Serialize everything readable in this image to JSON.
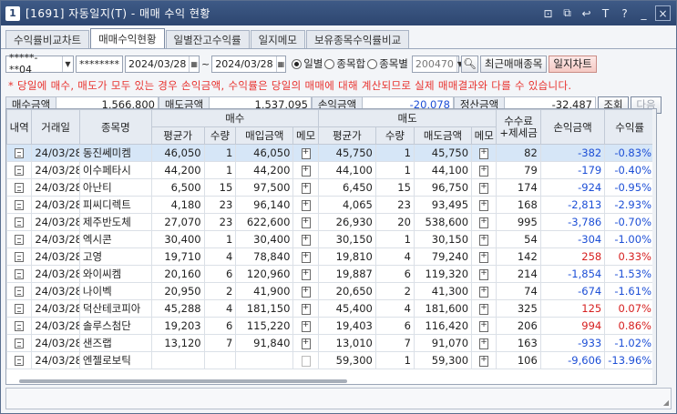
{
  "window": {
    "number": "1",
    "title": "[1691] 자동일지(T) - 매매 수익 현황"
  },
  "title_icons": [
    "⊡",
    "⧉",
    "↩",
    "T",
    "?",
    "_",
    "×"
  ],
  "tabs": [
    "수익률비교차트",
    "매매수익현황",
    "일별잔고수익률",
    "일지메모",
    "보유종목수익률비교"
  ],
  "active_tab": 1,
  "toolbar": {
    "account": "*****-**04",
    "password": "********",
    "date_from": "2024/03/28",
    "date_sep": "~",
    "date_to": "2024/03/28",
    "radio_options": [
      "일별",
      "종목합",
      "종목별"
    ],
    "radio_selected": 0,
    "stock_code": "200470",
    "recent_btn": "최근매매종목",
    "chart_btn": "일지차트"
  },
  "notice": "* 당일에 매수, 매도가 모두 있는 경우 손익금액, 수익률은 당일의 매매에 대해 계산되므로 실제 매매결과와 다를 수 있습니다.",
  "summary": {
    "buy_label": "매수금액",
    "buy_value": "1,566,800",
    "sell_label": "매도금액",
    "sell_value": "1,537,095",
    "pnl_label": "손익금액",
    "pnl_value": "-20,078",
    "settle_label": "정산금액",
    "settle_value": "-32,487",
    "query_btn": "조회",
    "next_btn": "다음"
  },
  "table": {
    "headers": {
      "detail": "내역",
      "date": "거래일",
      "name": "종목명",
      "buy": "매수",
      "sell": "매도",
      "fee": "수수료\n+제세금",
      "pnl": "손익금액",
      "rate": "수익률",
      "avg": "평균가",
      "qty": "수량",
      "buy_amt": "매입금액",
      "memo": "메모",
      "sell_amt": "매도금액"
    },
    "rows": [
      {
        "date": "24/03/28",
        "name": "동진쎄미켐",
        "b_avg": "46,050",
        "b_qty": "1",
        "b_amt": "46,050",
        "s_avg": "45,750",
        "s_qty": "1",
        "s_amt": "45,750",
        "fee": "82",
        "pnl": "-382",
        "rate": "-0.83%",
        "sign": "neg",
        "sel": true
      },
      {
        "date": "24/03/28",
        "name": "이수페타시",
        "b_avg": "44,200",
        "b_qty": "1",
        "b_amt": "44,200",
        "s_avg": "44,100",
        "s_qty": "1",
        "s_amt": "44,100",
        "fee": "79",
        "pnl": "-179",
        "rate": "-0.40%",
        "sign": "neg"
      },
      {
        "date": "24/03/28",
        "name": "아난티",
        "b_avg": "6,500",
        "b_qty": "15",
        "b_amt": "97,500",
        "s_avg": "6,450",
        "s_qty": "15",
        "s_amt": "96,750",
        "fee": "174",
        "pnl": "-924",
        "rate": "-0.95%",
        "sign": "neg"
      },
      {
        "date": "24/03/28",
        "name": "피씨디렉트",
        "b_avg": "4,180",
        "b_qty": "23",
        "b_amt": "96,140",
        "s_avg": "4,065",
        "s_qty": "23",
        "s_amt": "93,495",
        "fee": "168",
        "pnl": "-2,813",
        "rate": "-2.93%",
        "sign": "neg"
      },
      {
        "date": "24/03/28",
        "name": "제주반도체",
        "b_avg": "27,070",
        "b_qty": "23",
        "b_amt": "622,600",
        "s_avg": "26,930",
        "s_qty": "20",
        "s_amt": "538,600",
        "fee": "995",
        "pnl": "-3,786",
        "rate": "-0.70%",
        "sign": "neg"
      },
      {
        "date": "24/03/28",
        "name": "엑시콘",
        "b_avg": "30,400",
        "b_qty": "1",
        "b_amt": "30,400",
        "s_avg": "30,150",
        "s_qty": "1",
        "s_amt": "30,150",
        "fee": "54",
        "pnl": "-304",
        "rate": "-1.00%",
        "sign": "neg"
      },
      {
        "date": "24/03/28",
        "name": "고영",
        "b_avg": "19,710",
        "b_qty": "4",
        "b_amt": "78,840",
        "s_avg": "19,810",
        "s_qty": "4",
        "s_amt": "79,240",
        "fee": "142",
        "pnl": "258",
        "rate": "0.33%",
        "sign": "pos"
      },
      {
        "date": "24/03/28",
        "name": "와이씨켐",
        "b_avg": "20,160",
        "b_qty": "6",
        "b_amt": "120,960",
        "s_avg": "19,887",
        "s_qty": "6",
        "s_amt": "119,320",
        "fee": "214",
        "pnl": "-1,854",
        "rate": "-1.53%",
        "sign": "neg"
      },
      {
        "date": "24/03/28",
        "name": "나이벡",
        "b_avg": "20,950",
        "b_qty": "2",
        "b_amt": "41,900",
        "s_avg": "20,650",
        "s_qty": "2",
        "s_amt": "41,300",
        "fee": "74",
        "pnl": "-674",
        "rate": "-1.61%",
        "sign": "neg"
      },
      {
        "date": "24/03/28",
        "name": "덕산테코피아",
        "b_avg": "45,288",
        "b_qty": "4",
        "b_amt": "181,150",
        "s_avg": "45,400",
        "s_qty": "4",
        "s_amt": "181,600",
        "fee": "325",
        "pnl": "125",
        "rate": "0.07%",
        "sign": "pos"
      },
      {
        "date": "24/03/28",
        "name": "솔루스첨단",
        "b_avg": "19,203",
        "b_qty": "6",
        "b_amt": "115,220",
        "s_avg": "19,403",
        "s_qty": "6",
        "s_amt": "116,420",
        "fee": "206",
        "pnl": "994",
        "rate": "0.86%",
        "sign": "pos"
      },
      {
        "date": "24/03/28",
        "name": "샌즈랩",
        "b_avg": "13,120",
        "b_qty": "7",
        "b_amt": "91,840",
        "s_avg": "13,010",
        "s_qty": "7",
        "s_amt": "91,070",
        "fee": "163",
        "pnl": "-933",
        "rate": "-1.02%",
        "sign": "neg"
      },
      {
        "date": "24/03/28",
        "name": "엔젤로보틱",
        "b_avg": "",
        "b_qty": "",
        "b_amt": "",
        "s_avg": "59,300",
        "s_qty": "1",
        "s_amt": "59,300",
        "fee": "106",
        "pnl": "-9,606",
        "rate": "-13.96%",
        "sign": "neg",
        "no_buy_memo": true
      }
    ]
  }
}
